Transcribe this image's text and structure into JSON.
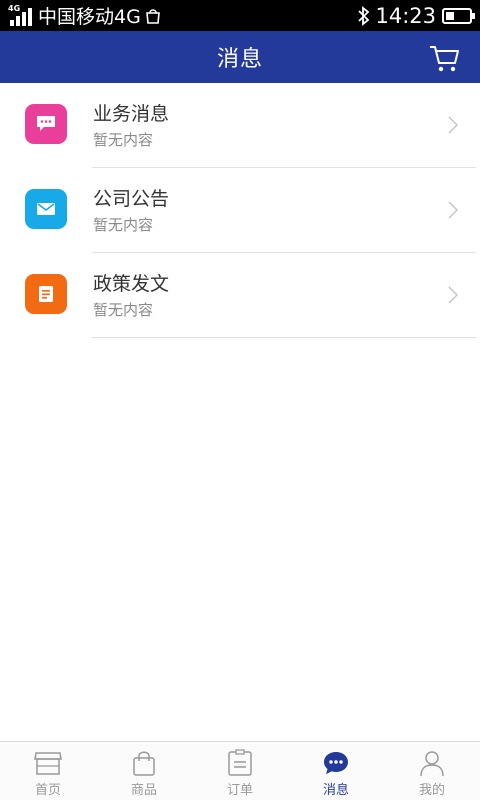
{
  "status_bar": {
    "network_type": "4G",
    "carrier": "中国移动4G",
    "time": "14:23",
    "battery_level": 0.35,
    "icons": [
      "signal-icon",
      "shopping-bag-icon",
      "bluetooth-icon",
      "battery-icon"
    ]
  },
  "header": {
    "title": "消息",
    "cart_icon": "cart-icon"
  },
  "messages": [
    {
      "title": "业务消息",
      "subtitle": "暂无内容",
      "icon": "chat-bubble-icon",
      "color": "#e93f9a"
    },
    {
      "title": "公司公告",
      "subtitle": "暂无内容",
      "icon": "mail-icon",
      "color": "#18a9e8"
    },
    {
      "title": "政策发文",
      "subtitle": "暂无内容",
      "icon": "document-icon",
      "color": "#f26a12"
    }
  ],
  "tabs": [
    {
      "label": "首页",
      "icon": "home-store-icon",
      "active": false
    },
    {
      "label": "商品",
      "icon": "shopping-bag-icon",
      "active": false
    },
    {
      "label": "订单",
      "icon": "clipboard-icon",
      "active": false
    },
    {
      "label": "消息",
      "icon": "message-bubble-icon",
      "active": true
    },
    {
      "label": "我的",
      "icon": "user-icon",
      "active": false
    }
  ],
  "colors": {
    "brand": "#233a9a",
    "tab_inactive": "#9a9a9a",
    "text_primary": "#333333",
    "text_secondary": "#8a8a8a"
  }
}
